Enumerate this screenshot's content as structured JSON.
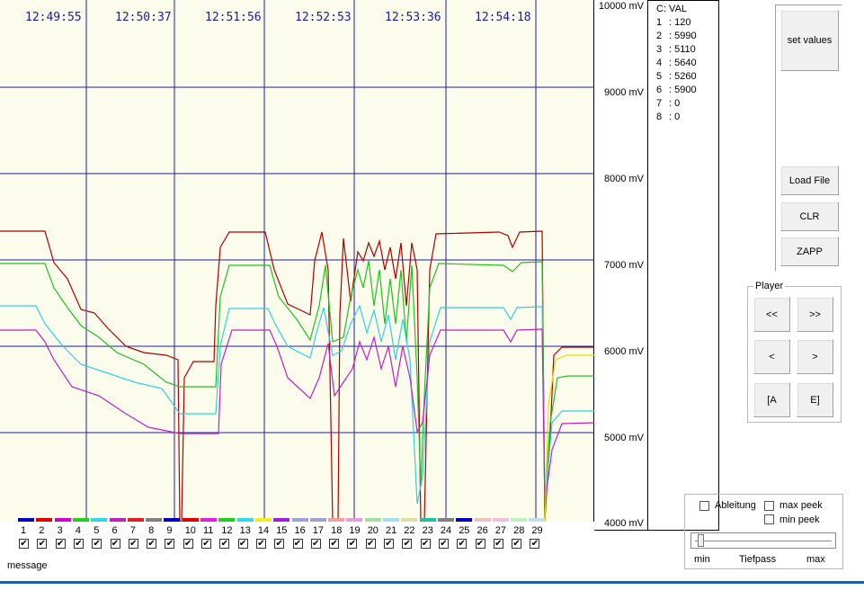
{
  "plot": {
    "bg": "#fcfcec",
    "grid_color": "#2020a0",
    "time_labels": [
      "12:49:55",
      "12:50:37",
      "12:51:56",
      "12:52:53",
      "12:53:36",
      "12:54:18"
    ],
    "y_labels": [
      "10000 mV",
      "9000 mV",
      "8000 mV",
      "7000 mV",
      "6000 mV",
      "5000 mV",
      "4000 mV"
    ],
    "series_colors": [
      "#b00000",
      "#20c020",
      "#30d0e0",
      "#c020c0",
      "#e0e000"
    ]
  },
  "values_panel": {
    "header": "C: VAL",
    "rows": [
      {
        "idx": "1",
        "val": ": 120"
      },
      {
        "idx": "2",
        "val": ": 5990"
      },
      {
        "idx": "3",
        "val": ": 5110"
      },
      {
        "idx": "4",
        "val": ": 5640"
      },
      {
        "idx": "5",
        "val": ": 5260"
      },
      {
        "idx": "6",
        "val": ": 5900"
      },
      {
        "idx": "7",
        "val": ": 0"
      },
      {
        "idx": "8",
        "val": ": 0"
      }
    ]
  },
  "buttons": {
    "set_values": "set values",
    "load_file": "Load File",
    "clr": "CLR",
    "zapp": "ZAPP"
  },
  "player": {
    "title": "Player",
    "rewind": "<<",
    "fast_forward": ">>",
    "prev": "<",
    "next": ">",
    "start": "[A",
    "end": "E]"
  },
  "filter": {
    "ableitung": "Ableitung",
    "max_peek": "max peek",
    "min_peek": "min peek",
    "min": "min",
    "tiefpass": "Tiefpass",
    "max": "max",
    "slider_value": 0.02
  },
  "legend": {
    "channels": [
      {
        "num": "1",
        "color": "#0000c0",
        "checked": "✔"
      },
      {
        "num": "2",
        "color": "#e00000",
        "checked": "✔"
      },
      {
        "num": "3",
        "color": "#d000d0",
        "checked": "✔"
      },
      {
        "num": "4",
        "color": "#20d020",
        "checked": "✔"
      },
      {
        "num": "5",
        "color": "#30d8e8",
        "checked": "✔"
      },
      {
        "num": "6",
        "color": "#c020c0",
        "checked": "✔"
      },
      {
        "num": "7",
        "color": "#e02020",
        "checked": "✔"
      },
      {
        "num": "8",
        "color": "#808080",
        "checked": "✔"
      },
      {
        "num": "9",
        "color": "#0000c0",
        "checked": "✔"
      },
      {
        "num": "10",
        "color": "#e00000",
        "checked": "✔"
      },
      {
        "num": "11",
        "color": "#e020e0",
        "checked": "✔"
      },
      {
        "num": "12",
        "color": "#20d020",
        "checked": "✔"
      },
      {
        "num": "13",
        "color": "#30d8e8",
        "checked": "✔"
      },
      {
        "num": "14",
        "color": "#f0f020",
        "checked": "✔"
      },
      {
        "num": "15",
        "color": "#a020e0",
        "checked": "✔"
      },
      {
        "num": "16",
        "color": "#a0a0e0",
        "checked": "✔"
      },
      {
        "num": "17",
        "color": "#a0a0d0",
        "checked": "✔"
      },
      {
        "num": "18",
        "color": "#f0a0a0",
        "checked": "✔"
      },
      {
        "num": "19",
        "color": "#e0a0e0",
        "checked": "✔"
      },
      {
        "num": "20",
        "color": "#a0e0a0",
        "checked": "✔"
      },
      {
        "num": "21",
        "color": "#a0e0f0",
        "checked": "✔"
      },
      {
        "num": "22",
        "color": "#e0e0a0",
        "checked": "✔"
      },
      {
        "num": "23",
        "color": "#20c0a0",
        "checked": "✔"
      },
      {
        "num": "24",
        "color": "#808080",
        "checked": "✔"
      },
      {
        "num": "25",
        "color": "#0000c0",
        "checked": "✔"
      },
      {
        "num": "26",
        "color": "#f0c0c0",
        "checked": "✔"
      },
      {
        "num": "27",
        "color": "#f0c0e0",
        "checked": "✔"
      },
      {
        "num": "28",
        "color": "#c0f0c0",
        "checked": "✔"
      },
      {
        "num": "29",
        "color": "#c0e0f0",
        "checked": "✔"
      }
    ],
    "message": "message"
  }
}
